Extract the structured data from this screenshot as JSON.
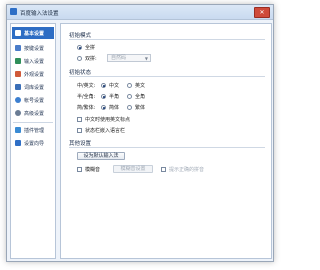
{
  "window": {
    "title": "百度输入法设置",
    "close_label": "✕"
  },
  "sidebar": {
    "items": [
      {
        "label": "基本设置",
        "icon": "grid-icon",
        "color": "#ffffff"
      },
      {
        "label": "按键设置",
        "icon": "keyboard-icon",
        "color": "#4a7cc9"
      },
      {
        "label": "输入设置",
        "icon": "input-icon",
        "color": "#2f8f5a"
      },
      {
        "label": "外观设置",
        "icon": "palette-icon",
        "color": "#d05a3a"
      },
      {
        "label": "词库设置",
        "icon": "book-icon",
        "color": "#3a6fb8"
      },
      {
        "label": "帐号设置",
        "icon": "user-icon",
        "color": "#3c7fd0"
      },
      {
        "label": "高级设置",
        "icon": "gear-icon",
        "color": "#6a7c94"
      },
      {
        "label": "插件管理",
        "icon": "plugin-icon",
        "color": "#3a8bd4"
      },
      {
        "label": "设置向导",
        "icon": "wizard-icon",
        "color": "#2f6fc6"
      }
    ]
  },
  "default_mode": {
    "title": "初始模式",
    "options": [
      {
        "label": "全拼",
        "selected": true
      },
      {
        "label": "双拼:",
        "selected": false
      }
    ],
    "shuangpin_select": "自然码"
  },
  "initial_state": {
    "title": "初始状态",
    "rows": [
      {
        "label": "中/英文:",
        "options": [
          {
            "label": "中文",
            "selected": true
          },
          {
            "label": "英文",
            "selected": false
          }
        ]
      },
      {
        "label": "半/全角:",
        "options": [
          {
            "label": "半角",
            "selected": true
          },
          {
            "label": "全角",
            "selected": false
          }
        ]
      },
      {
        "label": "简/繁体:",
        "options": [
          {
            "label": "简体",
            "selected": true
          },
          {
            "label": "繁体",
            "selected": false
          }
        ]
      }
    ],
    "checkboxes": [
      {
        "label": "中文时使用英文标点",
        "checked": false
      },
      {
        "label": "状态栏嵌入语言栏",
        "checked": false
      }
    ]
  },
  "other_settings": {
    "title": "其他设置",
    "default_ime_button": "设为默认输入法",
    "fuzzy": {
      "label": "模糊音",
      "checked": false
    },
    "fuzzy_settings_button": "模糊音设置",
    "correction": {
      "label": "提示正确的拼音",
      "checked": false
    }
  }
}
